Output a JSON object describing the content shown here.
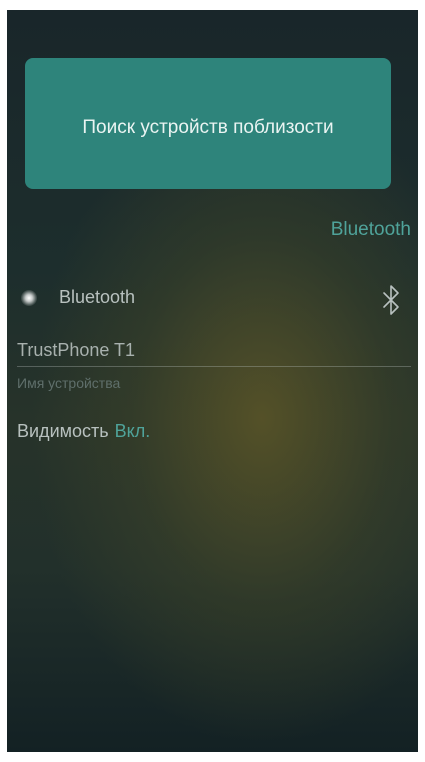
{
  "scan": {
    "label": "Поиск устройств поблизости"
  },
  "header": {
    "section_title": "Bluetooth"
  },
  "bluetooth": {
    "label": "Bluetooth",
    "icon": "bluetooth-icon"
  },
  "device": {
    "name": "TrustPhone T1",
    "caption": "Имя устройства"
  },
  "visibility": {
    "label": "Видимость",
    "value": "Вкл."
  },
  "colors": {
    "accent": "#4fa39a",
    "card": "#2e847b"
  }
}
